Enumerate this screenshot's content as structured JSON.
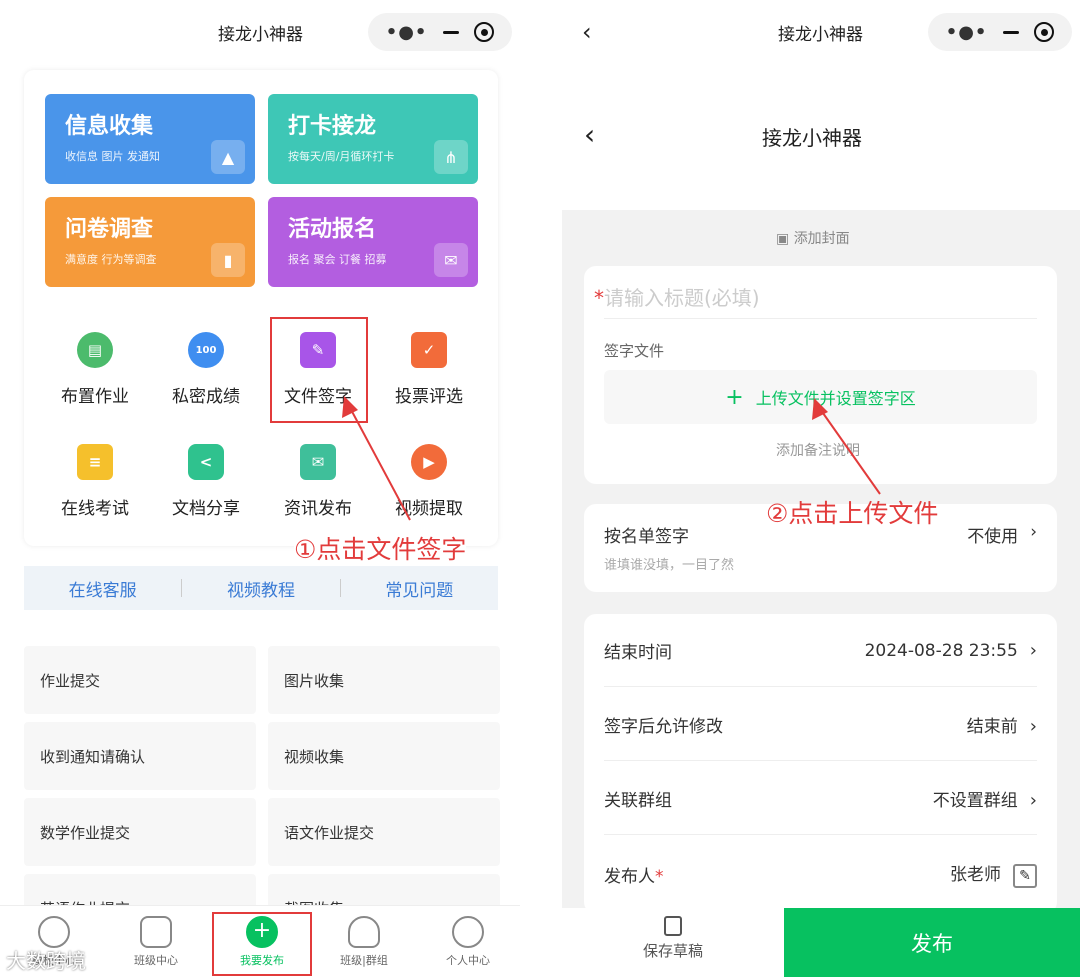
{
  "left": {
    "title": "接龙小神器",
    "tiles": [
      {
        "title": "信息收集",
        "subtitle": "收信息 图片 发通知",
        "color": "#4a95ea"
      },
      {
        "title": "打卡接龙",
        "subtitle": "按每天/周/月循环打卡",
        "color": "#3ec7b6"
      },
      {
        "title": "问卷调查",
        "subtitle": "满意度 行为等调查",
        "color": "#f59a3a"
      },
      {
        "title": "活动报名",
        "subtitle": "报名 聚会 订餐 招募",
        "color": "#b35ee0"
      }
    ],
    "grid": [
      {
        "label": "布置作业",
        "color": "#4cbb6c",
        "glyph": "▤"
      },
      {
        "label": "私密成绩",
        "color": "#3f8ef0",
        "glyph": "100"
      },
      {
        "label": "文件签字",
        "color": "#a855e8",
        "glyph": "✎"
      },
      {
        "label": "投票评选",
        "color": "#f26b3a",
        "glyph": "✓"
      },
      {
        "label": "在线考试",
        "color": "#f5c02c",
        "glyph": "≡"
      },
      {
        "label": "文档分享",
        "color": "#2fc28e",
        "glyph": "<"
      },
      {
        "label": "资讯发布",
        "color": "#3fbf9a",
        "glyph": "✉"
      },
      {
        "label": "视频提取",
        "color": "#f26b3a",
        "glyph": "▶"
      }
    ],
    "links": [
      "在线客服",
      "视频教程",
      "常见问题"
    ],
    "templates": [
      "作业提交",
      "图片收集",
      "收到通知请确认",
      "视频收集",
      "数学作业提交",
      "语文作业提交",
      "英语作业提交",
      "截图收集"
    ],
    "nav": [
      "模板中心",
      "班级中心",
      "我要发布",
      "班级|群组",
      "个人中心"
    ],
    "watermark": "大数跨境",
    "annotation": "①点击文件签字"
  },
  "right": {
    "title": "接龙小神器",
    "inner_title": "接龙小神器",
    "add_cover": "添加封面",
    "title_placeholder": "请输入标题(必填)",
    "sign_file_label": "签字文件",
    "upload_button": "上传文件并设置签字区",
    "add_note": "添加备注说明",
    "roster_label": "按名单签字",
    "roster_value": "不使用",
    "roster_hint": "谁填谁没填，一目了然",
    "end_time_label": "结束时间",
    "end_time_value": "2024-08-28 23:55",
    "modify_label": "签字后允许修改",
    "modify_value": "结束前",
    "group_label": "关联群组",
    "group_value": "不设置群组",
    "publisher_label": "发布人",
    "publisher_value": "张老师",
    "save_draft": "保存草稿",
    "publish": "发布",
    "annotation": "②点击上传文件"
  },
  "colors": {
    "accent": "#07c160",
    "annotation": "#e23b3b"
  }
}
